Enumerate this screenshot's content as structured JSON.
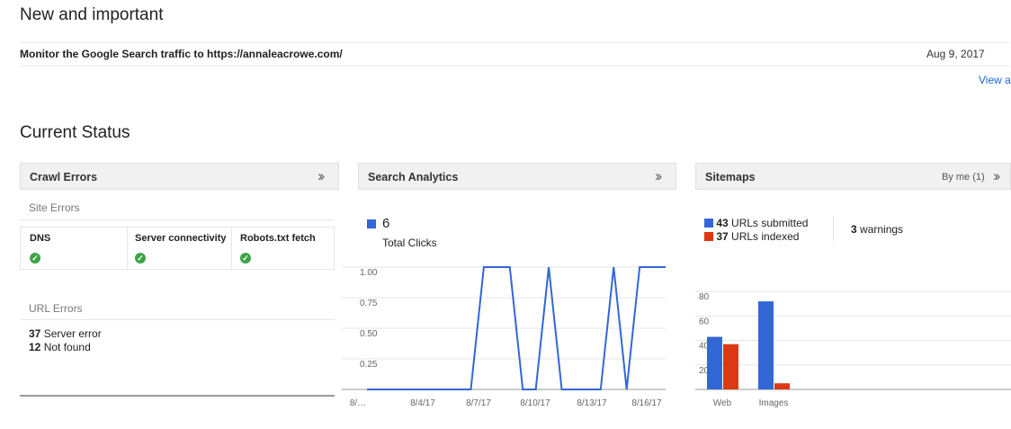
{
  "new_and_important": {
    "title": "New and important",
    "message": "Monitor the Google Search traffic to https://annaleacrowe.com/",
    "date": "Aug 9, 2017",
    "view_all": "View a"
  },
  "current_status": {
    "title": "Current Status"
  },
  "crawl_errors": {
    "title": "Crawl Errors",
    "site_errors_label": "Site Errors",
    "columns": [
      "DNS",
      "Server connectivity",
      "Robots.txt fetch"
    ],
    "url_errors_label": "URL Errors",
    "server_error": {
      "count": "37",
      "label": "Server error"
    },
    "not_found": {
      "count": "12",
      "label": "Not found"
    }
  },
  "search_analytics": {
    "title": "Search Analytics",
    "total_value": "6",
    "total_label": "Total Clicks",
    "accent": "#3367d6"
  },
  "sitemaps": {
    "title": "Sitemaps",
    "filter": "By me (1)",
    "submitted": {
      "count": "43",
      "label": "URLs submitted",
      "color": "#3367d6"
    },
    "indexed": {
      "count": "37",
      "label": "URLs indexed",
      "color": "#dc3912"
    },
    "warnings": {
      "count": "3",
      "label": "warnings"
    }
  },
  "chart_data": [
    {
      "type": "line",
      "x_tick_labels": [
        "8/…",
        "8/4/17",
        "8/7/17",
        "8/10/17",
        "8/13/17",
        "8/16/17"
      ],
      "y_tick_labels": [
        "1.00",
        "0.75",
        "0.50",
        "0.25"
      ],
      "ylim": [
        0,
        1
      ],
      "series": [
        {
          "values": [
            0,
            0,
            0,
            0,
            0,
            0,
            0,
            0,
            0,
            1,
            1,
            1,
            0,
            0,
            1,
            0,
            0,
            0,
            0,
            1,
            0,
            1,
            1,
            1
          ],
          "color": "#3367d6"
        }
      ],
      "grid": true
    },
    {
      "type": "bar",
      "categories": [
        "Web",
        "Images"
      ],
      "y_tick_labels": [
        "80",
        "60",
        "40",
        "20"
      ],
      "ylim": [
        0,
        100
      ],
      "series": [
        {
          "name": "URLs submitted",
          "values": [
            43,
            72
          ],
          "color": "#3367d6"
        },
        {
          "name": "URLs indexed",
          "values": [
            37,
            5
          ],
          "color": "#dc3912"
        }
      ],
      "grid": true
    }
  ]
}
